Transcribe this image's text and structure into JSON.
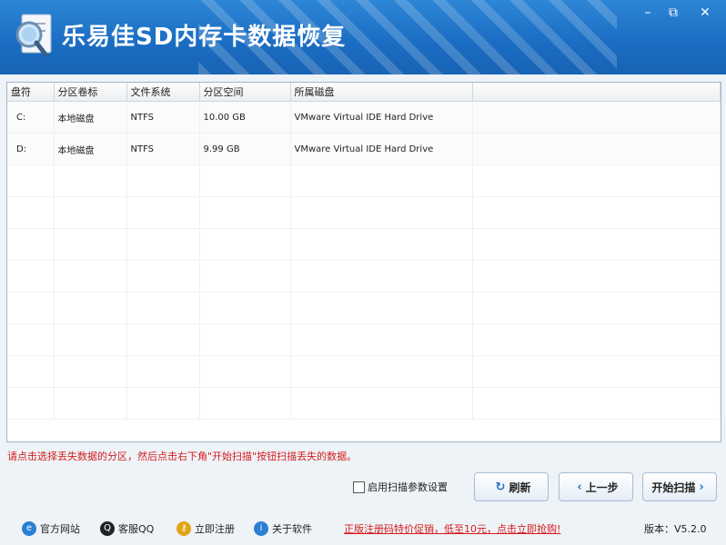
{
  "app": {
    "title": "乐易佳SD内存卡数据恢复"
  },
  "window_controls": {
    "minimize": "–",
    "restore": "⧉",
    "close": "✕"
  },
  "table": {
    "columns": [
      "盘符",
      "分区卷标",
      "文件系统",
      "分区空间",
      "所属磁盘"
    ],
    "rows": [
      {
        "drive": "C:",
        "label": "本地磁盘",
        "fs": "NTFS",
        "size": "10.00 GB",
        "disk": "VMware Virtual IDE Hard Drive"
      },
      {
        "drive": "D:",
        "label": "本地磁盘",
        "fs": "NTFS",
        "size": "9.99 GB",
        "disk": "VMware Virtual IDE Hard Drive"
      }
    ]
  },
  "hint": "请点击选择丢失数据的分区，然后点击右下角\"开始扫描\"按钮扫描丢失的数据。",
  "options": {
    "enable_scan_params": "启用扫描参数设置"
  },
  "buttons": {
    "refresh": "刷新",
    "prev": "上一步",
    "start_scan": "开始扫描"
  },
  "footer": {
    "links": [
      "官方网站",
      "客服QQ",
      "立即注册",
      "关于软件"
    ],
    "promo": "正版注册码特价促销，低至10元，点击立即抢购!",
    "version_label": "版本：",
    "version": "V5.2.0"
  },
  "colors": {
    "titlebar": "#1a6cc2",
    "hint": "#d41c1c",
    "accent": "#1e73c6"
  }
}
